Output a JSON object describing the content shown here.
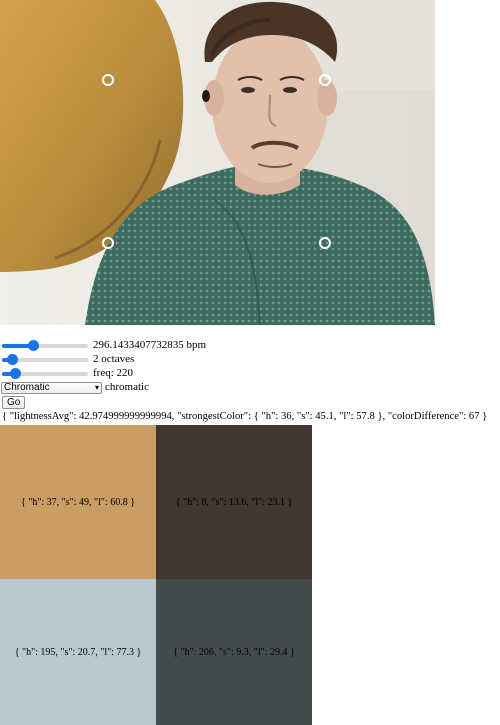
{
  "camera": {
    "description": "webcam frame with four corner sample markers"
  },
  "controls": {
    "bpm": {
      "value_text": "296.1433407732835 bpm",
      "slider_fraction": 0.37
    },
    "octaves": {
      "value_text": "2 octaves",
      "slider_fraction": 0.12
    },
    "freq": {
      "value_text": "freq: 220",
      "slider_fraction": 0.16
    },
    "scale": {
      "selected": "Chromatic",
      "label": "chromatic"
    },
    "go_label": "Go"
  },
  "summary_text": "{ \"lightnessAvg\": 42.974999999999994, \"strongestColor\": { \"h\": 36, \"s\": 45.1, \"l\": 57.8 }, \"colorDifference\": 67 }",
  "swatches": [
    {
      "text": "{ \"h\": 37, \"s\": 49, \"l\": 60.8 }",
      "color": "#c99d63"
    },
    {
      "text": "{ \"h\": 8, \"s\": 13.6, \"l\": 23.1 }",
      "color": "#433530"
    },
    {
      "text": "{ \"h\": 195, \"s\": 20.7, \"l\": 77.3 }",
      "color": "#b7c8d0"
    },
    {
      "text": "{ \"h\": 206, \"s\": 9.3, \"l\": 29.4 }",
      "color": "#444b4f"
    }
  ],
  "icons": {
    "sample_marker": "circle-marker-icon",
    "select_chevron": "chevron-down-icon"
  }
}
